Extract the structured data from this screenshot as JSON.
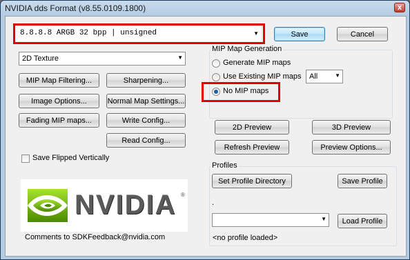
{
  "window": {
    "title": "NVIDIA dds Format (v8.55.0109.1800)",
    "close_glyph": "x"
  },
  "format_select": {
    "value": "8.8.8.8      ARGB  32 bpp | unsigned"
  },
  "buttons": {
    "save": "Save",
    "cancel": "Cancel",
    "mip_map_filtering": "MIP Map Filtering...",
    "sharpening": "Sharpening...",
    "image_options": "Image Options...",
    "normal_map_settings": "Normal Map Settings...",
    "fading_mip_maps": "Fading MIP maps...",
    "write_config": "Write Config...",
    "read_config": "Read Config...",
    "preview_2d": "2D Preview",
    "preview_3d": "3D Preview",
    "refresh_preview": "Refresh Preview",
    "preview_options": "Preview Options...",
    "set_profile_directory": "Set Profile Directory",
    "save_profile": "Save Profile",
    "load_profile": "Load Profile"
  },
  "texture_type": {
    "value": "2D Texture"
  },
  "mip_generation": {
    "label": "MIP Map Generation",
    "options": [
      "Generate MIP maps",
      "Use Existing MIP maps",
      "No MIP maps"
    ],
    "selected": "No MIP maps",
    "levels_select": "All"
  },
  "save_flipped": {
    "label": "Save Flipped Vertically",
    "checked": false
  },
  "logo": {
    "text": "NVIDIA",
    "reg": "®"
  },
  "comments": "Comments to SDKFeedback@nvidia.com",
  "profiles": {
    "label": "Profiles",
    "dot": ".",
    "select_value": "",
    "status": "<no profile loaded>"
  },
  "colors": {
    "highlight": "#e00000",
    "nvidia_green": "#76b900"
  }
}
